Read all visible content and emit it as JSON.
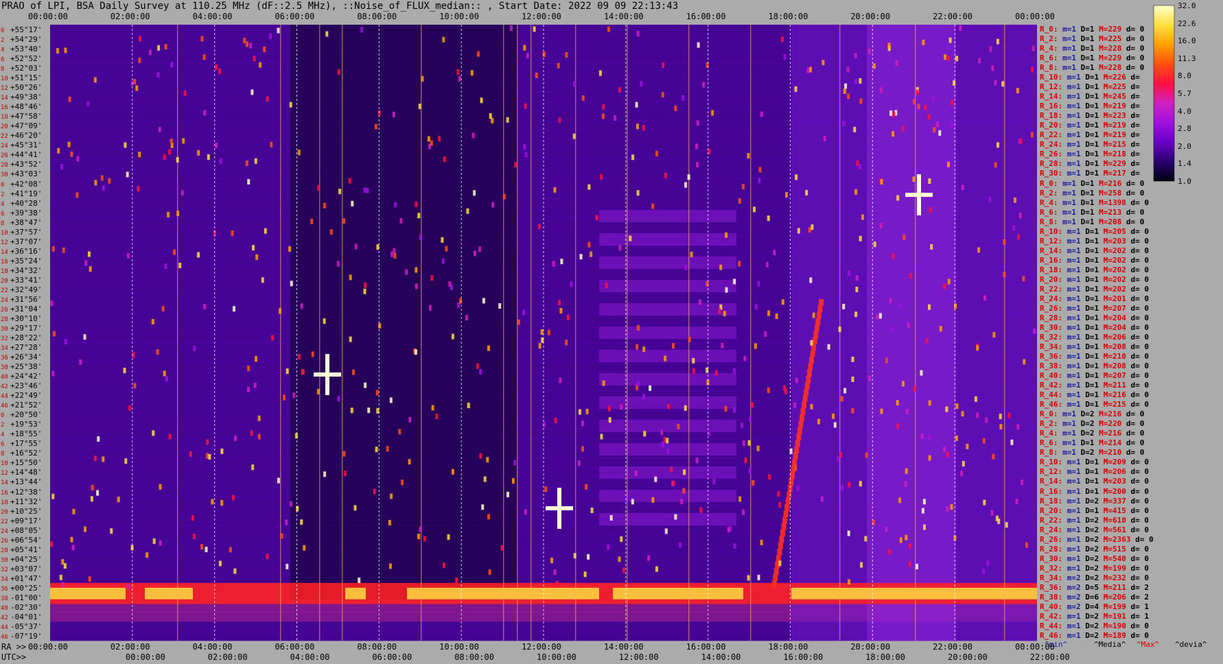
{
  "title": "PRAO of LPI, BSA Daily Survey at 110.25 MHz (dF::2.5 MHz), ::Noise_of_FLUX_median:: , Start Date: 2022 09 09 22:13:43",
  "chart_data": {
    "type": "heatmap",
    "title": "PRAO of LPI, BSA Daily Survey at 110.25 MHz (dF::2.5 MHz), ::Noise_of_FLUX_median:: , Start Date: 2022 09 09 22:13:43",
    "x_top_ticks": [
      "00:00:00",
      "02:00:00",
      "04:00:00",
      "06:00:00",
      "08:00:00",
      "10:00:00",
      "12:00:00",
      "14:00:00",
      "16:00:00",
      "18:00:00",
      "20:00:00",
      "22:00:00",
      "00:00:00"
    ],
    "x_bottom_ra_ticks": [
      "00:00:00",
      "02:00:00",
      "04:00:00",
      "06:00:00",
      "08:00:00",
      "10:00:00",
      "12:00:00",
      "14:00:00",
      "16:00:00",
      "18:00:00",
      "20:00:00",
      "22:00:00",
      "00:00:00"
    ],
    "x_bottom_utc_ticks": [
      "00:00:00",
      "02:00:00",
      "04:00:00",
      "06:00:00",
      "08:00:00",
      "10:00:00",
      "12:00:00",
      "14:00:00",
      "16:00:00",
      "18:00:00",
      "20:00:00",
      "22:00:00"
    ],
    "ra_label": "RA >>",
    "utc_label": "UTC>>",
    "dec_labels": [
      "+55°17'",
      "+54°29'",
      "+53°40'",
      "+52°52'",
      "+52°03'",
      "+51°15'",
      "+50°26'",
      "+49°38'",
      "+48°46'",
      "+47°58'",
      "+47°09'",
      "+46°20'",
      "+45°31'",
      "+44°41'",
      "+43°52'",
      "+43°03'",
      "+42°08'",
      "+41°19'",
      "+40°28'",
      "+39°38'",
      "+38°47'",
      "+37°57'",
      "+37°07'",
      "+36°16'",
      "+35°24'",
      "+34°32'",
      "+33°41'",
      "+32°49'",
      "+31°56'",
      "+31°04'",
      "+30°10'",
      "+29°17'",
      "+28°22'",
      "+27°28'",
      "+26°34'",
      "+25°38'",
      "+24°42'",
      "+23°46'",
      "+22°49'",
      "+21°52'",
      "+20°50'",
      "+19°53'",
      "+18°55'",
      "+17°55'",
      "+16°52'",
      "+15°50'",
      "+14°48'",
      "+13°44'",
      "+12°38'",
      "+11°32'",
      "+10°25'",
      "+09°17'",
      "+08°05'",
      "+06°54'",
      "+05°41'",
      "+04°25'",
      "+03°07'",
      "+01°47'",
      "+00°25'",
      "-01°00'",
      "-02°30'",
      "-04°01'",
      "-05°37'",
      "-07°19'"
    ],
    "dec_index": [
      "0",
      "2",
      "4",
      "6",
      "8",
      "10",
      "12",
      "14",
      "16",
      "18",
      "20",
      "22",
      "24",
      "26",
      "28",
      "30",
      "0",
      "2",
      "4",
      "6",
      "8",
      "10",
      "12",
      "14",
      "16",
      "18",
      "20",
      "22",
      "24",
      "26",
      "28",
      "30",
      "32",
      "34",
      "36",
      "38",
      "40",
      "42",
      "44",
      "46",
      "0",
      "2",
      "4",
      "6",
      "8",
      "10",
      "12",
      "14",
      "16",
      "18",
      "20",
      "22",
      "24",
      "26",
      "28",
      "30",
      "32",
      "34",
      "36",
      "38",
      "40",
      "42",
      "44",
      "46"
    ],
    "colorbar_ticks": [
      "32.0",
      "22.6",
      "16.0",
      "11.3",
      "8.0",
      "5.7",
      "4.0",
      "2.8",
      "2.0",
      "1.4",
      "1.0"
    ],
    "colorbar_colors": [
      "#000010",
      "#2a0070",
      "#6a00c8",
      "#a010e0",
      "#d020c0",
      "#ff1040",
      "#ff5010",
      "#ffa000",
      "#ffe040",
      "#ffffc8"
    ],
    "row_stats": [
      {
        "r": "R_0:",
        "m": "m=1",
        "D": "D=1",
        "M": "M=229",
        "d": "d= 0"
      },
      {
        "r": "R_2:",
        "m": "m=1",
        "D": "D=1",
        "M": "M=225",
        "d": "d= 0"
      },
      {
        "r": "R_4:",
        "m": "m=1",
        "D": "D=1",
        "M": "M=228",
        "d": "d= 0"
      },
      {
        "r": "R_6:",
        "m": "m=1",
        "D": "D=1",
        "M": "M=229",
        "d": "d= 0"
      },
      {
        "r": "R_8:",
        "m": "m=1",
        "D": "D=1",
        "M": "M=228",
        "d": "d= 0"
      },
      {
        "r": "R_10:",
        "m": "m=1",
        "D": "D=1",
        "M": "M=226",
        "d": "d="
      },
      {
        "r": "R_12:",
        "m": "m=1",
        "D": "D=1",
        "M": "M=225",
        "d": "d="
      },
      {
        "r": "R_14:",
        "m": "m=1",
        "D": "D=1",
        "M": "M=245",
        "d": "d="
      },
      {
        "r": "R_16:",
        "m": "m=1",
        "D": "D=1",
        "M": "M=219",
        "d": "d="
      },
      {
        "r": "R_18:",
        "m": "m=1",
        "D": "D=1",
        "M": "M=223",
        "d": "d="
      },
      {
        "r": "R_20:",
        "m": "m=1",
        "D": "D=1",
        "M": "M=219",
        "d": "d="
      },
      {
        "r": "R_22:",
        "m": "m=1",
        "D": "D=1",
        "M": "M=219",
        "d": "d="
      },
      {
        "r": "R_24:",
        "m": "m=1",
        "D": "D=1",
        "M": "M=215",
        "d": "d="
      },
      {
        "r": "R_26:",
        "m": "m=1",
        "D": "D=1",
        "M": "M=218",
        "d": "d="
      },
      {
        "r": "R_28:",
        "m": "m=1",
        "D": "D=1",
        "M": "M=229",
        "d": "d="
      },
      {
        "r": "R_30:",
        "m": "m=1",
        "D": "D=1",
        "M": "M=217",
        "d": "d="
      },
      {
        "r": "R_0:",
        "m": "m=1",
        "D": "D=1",
        "M": "M=216",
        "d": "d= 0"
      },
      {
        "r": "R_2:",
        "m": "m=1",
        "D": "D=1",
        "M": "M=258",
        "d": "d= 0"
      },
      {
        "r": "R_4:",
        "m": "m=1",
        "D": "D=1",
        "M": "M=1398",
        "d": "d= 0"
      },
      {
        "r": "R_6:",
        "m": "m=1",
        "D": "D=1",
        "M": "M=213",
        "d": "d= 0"
      },
      {
        "r": "R_8:",
        "m": "m=1",
        "D": "D=1",
        "M": "M=208",
        "d": "d= 0"
      },
      {
        "r": "R_10:",
        "m": "m=1",
        "D": "D=1",
        "M": "M=205",
        "d": "d= 0"
      },
      {
        "r": "R_12:",
        "m": "m=1",
        "D": "D=1",
        "M": "M=203",
        "d": "d= 0"
      },
      {
        "r": "R_14:",
        "m": "m=1",
        "D": "D=1",
        "M": "M=202",
        "d": "d= 0"
      },
      {
        "r": "R_16:",
        "m": "m=1",
        "D": "D=1",
        "M": "M=202",
        "d": "d= 0"
      },
      {
        "r": "R_18:",
        "m": "m=1",
        "D": "D=1",
        "M": "M=202",
        "d": "d= 0"
      },
      {
        "r": "R_20:",
        "m": "m=1",
        "D": "D=1",
        "M": "M=202",
        "d": "d= 0"
      },
      {
        "r": "R_22:",
        "m": "m=1",
        "D": "D=1",
        "M": "M=202",
        "d": "d= 0"
      },
      {
        "r": "R_24:",
        "m": "m=1",
        "D": "D=1",
        "M": "M=201",
        "d": "d= 0"
      },
      {
        "r": "R_26:",
        "m": "m=1",
        "D": "D=1",
        "M": "M=207",
        "d": "d= 0"
      },
      {
        "r": "R_28:",
        "m": "m=1",
        "D": "D=1",
        "M": "M=204",
        "d": "d= 0"
      },
      {
        "r": "R_30:",
        "m": "m=1",
        "D": "D=1",
        "M": "M=204",
        "d": "d= 0"
      },
      {
        "r": "R_32:",
        "m": "m=1",
        "D": "D=1",
        "M": "M=206",
        "d": "d= 0"
      },
      {
        "r": "R_34:",
        "m": "m=1",
        "D": "D=1",
        "M": "M=208",
        "d": "d= 0"
      },
      {
        "r": "R_36:",
        "m": "m=1",
        "D": "D=1",
        "M": "M=210",
        "d": "d= 0"
      },
      {
        "r": "R_38:",
        "m": "m=1",
        "D": "D=1",
        "M": "M=208",
        "d": "d= 0"
      },
      {
        "r": "R_40:",
        "m": "m=1",
        "D": "D=1",
        "M": "M=207",
        "d": "d= 0"
      },
      {
        "r": "R_42:",
        "m": "m=1",
        "D": "D=1",
        "M": "M=211",
        "d": "d= 0"
      },
      {
        "r": "R_44:",
        "m": "m=1",
        "D": "D=1",
        "M": "M=216",
        "d": "d= 0"
      },
      {
        "r": "R_46:",
        "m": "m=1",
        "D": "D=1",
        "M": "M=215",
        "d": "d= 0"
      },
      {
        "r": "R_0:",
        "m": "m=1",
        "D": "D=2",
        "M": "M=216",
        "d": "d= 0"
      },
      {
        "r": "R_2:",
        "m": "m=1",
        "D": "D=2",
        "M": "M=220",
        "d": "d= 0"
      },
      {
        "r": "R_4:",
        "m": "m=1",
        "D": "D=2",
        "M": "M=216",
        "d": "d= 0"
      },
      {
        "r": "R_6:",
        "m": "m=1",
        "D": "D=1",
        "M": "M=214",
        "d": "d= 0"
      },
      {
        "r": "R_8:",
        "m": "m=1",
        "D": "D=2",
        "M": "M=210",
        "d": "d= 0"
      },
      {
        "r": "R_10:",
        "m": "m=1",
        "D": "D=1",
        "M": "M=209",
        "d": "d= 0"
      },
      {
        "r": "R_12:",
        "m": "m=1",
        "D": "D=1",
        "M": "M=206",
        "d": "d= 0"
      },
      {
        "r": "R_14:",
        "m": "m=1",
        "D": "D=1",
        "M": "M=203",
        "d": "d= 0"
      },
      {
        "r": "R_16:",
        "m": "m=1",
        "D": "D=1",
        "M": "M=200",
        "d": "d= 0"
      },
      {
        "r": "R_18:",
        "m": "m=1",
        "D": "D=2",
        "M": "M=337",
        "d": "d= 0"
      },
      {
        "r": "R_20:",
        "m": "m=1",
        "D": "D=1",
        "M": "M=415",
        "d": "d= 0"
      },
      {
        "r": "R_22:",
        "m": "m=1",
        "D": "D=2",
        "M": "M=610",
        "d": "d= 0"
      },
      {
        "r": "R_24:",
        "m": "m=1",
        "D": "D=2",
        "M": "M=561",
        "d": "d= 0"
      },
      {
        "r": "R_26:",
        "m": "m=1",
        "D": "D=2",
        "M": "M=2363",
        "d": "d= 0"
      },
      {
        "r": "R_28:",
        "m": "m=1",
        "D": "D=2",
        "M": "M=515",
        "d": "d= 0"
      },
      {
        "r": "R_30:",
        "m": "m=1",
        "D": "D=2",
        "M": "M=540",
        "d": "d= 0"
      },
      {
        "r": "R_32:",
        "m": "m=1",
        "D": "D=2",
        "M": "M=199",
        "d": "d= 0"
      },
      {
        "r": "R_34:",
        "m": "m=2",
        "D": "D=2",
        "M": "M=232",
        "d": "d= 0"
      },
      {
        "r": "R_36:",
        "m": "m=2",
        "D": "D=5",
        "M": "M=211",
        "d": "d= 2"
      },
      {
        "r": "R_38:",
        "m": "m=2",
        "D": "D=6",
        "M": "M=206",
        "d": "d= 2"
      },
      {
        "r": "R_40:",
        "m": "m=2",
        "D": "D=4",
        "M": "M=199",
        "d": "d= 1"
      },
      {
        "r": "R_42:",
        "m": "m=1",
        "D": "D=2",
        "M": "M=191",
        "d": "d= 1"
      },
      {
        "r": "R_44:",
        "m": "m=1",
        "D": "D=2",
        "M": "M=190",
        "d": "d= 0"
      },
      {
        "r": "R_46:",
        "m": "m=1",
        "D": "D=2",
        "M": "M=189",
        "d": "d= 0"
      }
    ],
    "legend_footer": {
      "min": "^min^",
      "median": "^Media^",
      "max": "^Max^",
      "devia": "^devia^"
    }
  }
}
